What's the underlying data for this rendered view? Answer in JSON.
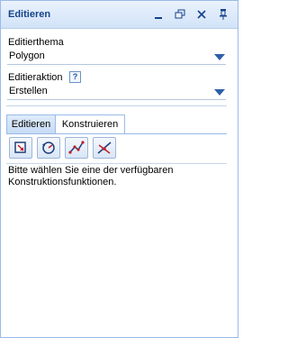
{
  "panel": {
    "title": "Editieren",
    "tools": {
      "minimize": "minimize-icon",
      "restore": "restore-icon",
      "close": "close-icon",
      "pin": "pin-icon"
    }
  },
  "theme": {
    "label": "Editierthema",
    "value": "Polygon"
  },
  "action": {
    "label": "Editieraktion",
    "help_icon": "?",
    "value": "Erstellen"
  },
  "tabs": [
    {
      "label": "Editieren",
      "active": true
    },
    {
      "label": "Konstruieren",
      "active": false
    }
  ],
  "toolbar": {
    "buttons": [
      "snap-square-icon",
      "rotate-circle-icon",
      "polyline-icon",
      "intersect-icon"
    ]
  },
  "info": {
    "text": "Bitte wählen Sie eine der verfügbaren Konstruktionsfunktionen."
  },
  "colors": {
    "title": "#15428b",
    "border": "#99bbe8",
    "arrow": "#2f5fa8"
  }
}
